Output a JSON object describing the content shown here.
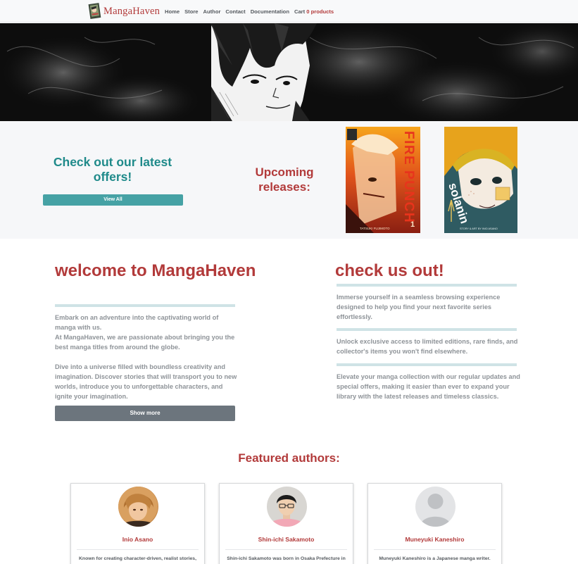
{
  "navbar": {
    "brand": "MangaHaven",
    "links": [
      "Home",
      "Store",
      "Author",
      "Contact",
      "Documentation"
    ],
    "cart_label": "Cart",
    "cart_count": "0 products"
  },
  "offers": {
    "heading": "Check out our latest offers!",
    "view_all_label": "View All",
    "upcoming_heading": "Upcoming releases:",
    "covers": [
      {
        "title": "FIRE PUNCH",
        "author": "TATSUKI FUJIMOTO",
        "volume": "1"
      },
      {
        "title": "solanin",
        "author": "STORY & ART BY INIO ASANO"
      }
    ]
  },
  "welcome": {
    "title": "welcome to MangaHaven",
    "paragraphs": [
      "Embark on an adventure into the captivating world of manga with us.",
      "At MangaHaven, we are passionate about bringing you the best manga titles from around the globe.",
      "Dive into a universe filled with boundless creativity and imagination. Discover stories that will transport you to new worlds, introduce you to unforgettable characters, and ignite your imagination."
    ],
    "show_more_label": "Show more"
  },
  "check": {
    "title": "check us out!",
    "items": [
      "Immerse yourself in a seamless browsing experience designed to help you find your next favorite series effortlessly.",
      "Unlock exclusive access to limited editions, rare finds, and collector's items you won't find elsewhere.",
      "Elevate your manga collection with our regular updates and special offers, making it easier than ever to expand your library with the latest releases and timeless classics."
    ]
  },
  "featured": {
    "title": "Featured authors:",
    "authors": [
      {
        "name": "Inio Asano",
        "desc": "Known for creating character-driven, realist stories,"
      },
      {
        "name": "Shin-ichi Sakamoto",
        "desc": "Shin-ichi Sakamoto was born in Osaka Prefecture in"
      },
      {
        "name": "Muneyuki Kaneshiro",
        "desc": "Muneyuki Kaneshiro is a Japanese manga writer."
      }
    ]
  },
  "colors": {
    "brand_red": "#b23a3a",
    "teal": "#1f8a8a",
    "teal_button": "#46a2a5",
    "gray_button": "#6c757d",
    "body_text": "#8e9398"
  }
}
